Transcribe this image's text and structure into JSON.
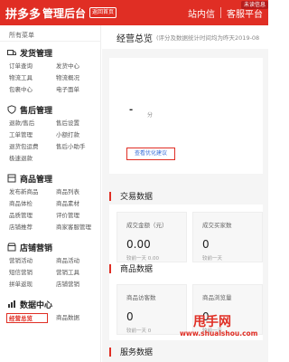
{
  "header": {
    "logo": "拼多多",
    "title": "管理后台",
    "back_home": "返回首页",
    "inbox": "站内信",
    "service": "客服平台",
    "badge": "未读信息"
  },
  "sidebar": {
    "all_menu": "所有菜单",
    "groups": [
      {
        "title": "发货管理",
        "icon": "truck-icon",
        "items": [
          "订单查询",
          "发货中心",
          "物流工具",
          "物流概况",
          "包裹中心",
          "电子面单"
        ]
      },
      {
        "title": "售后管理",
        "icon": "after-sale-icon",
        "items": [
          "退款/售后",
          "售后设置",
          "工单管理",
          "小额打款",
          "退货包运费",
          "售后小助手",
          "极速退款"
        ]
      },
      {
        "title": "商品管理",
        "icon": "goods-icon",
        "items": [
          "发布新商品",
          "商品列表",
          "商品体检",
          "商品素材",
          "品质管理",
          "评价管理",
          "店铺推荐",
          "商家客服管理"
        ]
      },
      {
        "title": "店铺营销",
        "icon": "shop-icon",
        "items": [
          "营销活动",
          "商品活动",
          "短信营销",
          "营销工具",
          "拼单返现",
          "店铺营销"
        ]
      },
      {
        "title": "数据中心",
        "icon": "data-icon",
        "items": [
          "经营总览",
          "商品数据"
        ]
      }
    ],
    "active": "经营总览"
  },
  "main": {
    "title": "经营总览",
    "subtitle": "(评分及数据统计时间均为昨天2019-08",
    "score_value": "-",
    "score_unit": "分",
    "suggest_button": "查看优化建议",
    "trade_section": "交易数据",
    "trade_metrics": [
      {
        "label": "成交金额（元）",
        "value": "0.00",
        "compare": "较前一天  0.00"
      },
      {
        "label": "成交买家数",
        "value": "0",
        "compare": "较前一天"
      }
    ],
    "goods_section": "商品数据",
    "goods_metrics": [
      {
        "label": "商品访客数",
        "value": "0",
        "compare": "较前一天  0"
      },
      {
        "label": "商品浏览量",
        "value": "0",
        "compare": "较前一天"
      }
    ],
    "service_section": "服务数据"
  },
  "watermark": {
    "cn": "甩手网",
    "en": "www.shuaishou.com"
  },
  "colors": {
    "brand": "#e02e24",
    "link": "#3a6fd8"
  }
}
